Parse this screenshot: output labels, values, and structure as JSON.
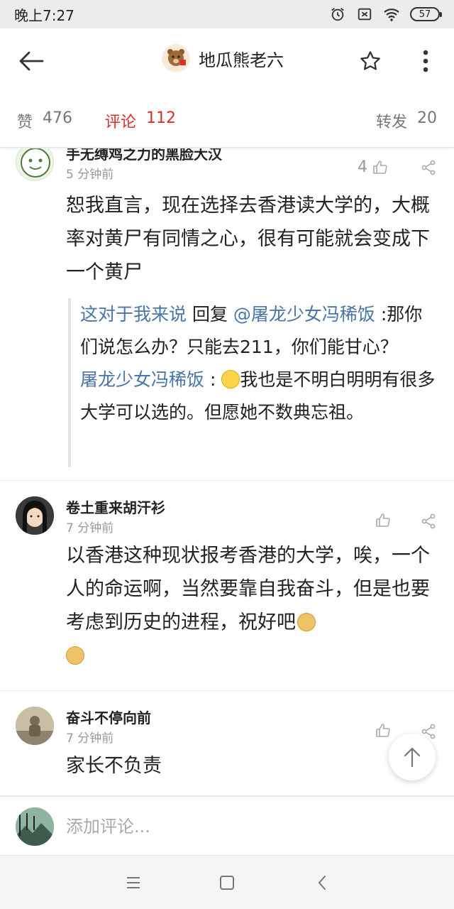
{
  "status_bar": {
    "time": "晚上7:27",
    "battery": "57"
  },
  "header": {
    "title": "地瓜熊老六"
  },
  "tabs": [
    {
      "label": "赞",
      "count": "476"
    },
    {
      "label": "评论",
      "count": "112"
    },
    {
      "label": "转发",
      "count": "20"
    }
  ],
  "comments": [
    {
      "name": "手无缚鸡之力的黑脸大汉",
      "time": "5 分钟前",
      "likes": "4",
      "body": "恕我直言，现在选择去香港读大学的，大概率对黄尸有同情之心，很有可能就会变成下一个黄尸",
      "replies": [
        {
          "author": "这对于我来说",
          "reply_word": " 回复 ",
          "target": "@屠龙少女冯稀饭",
          "text": " :那你们说怎么办？只能去211，你们能甘心？"
        },
        {
          "author": "屠龙少女冯稀饭",
          "colon": " : ",
          "text": "我也是不明白明明有很多大学可以选的。但愿她不数典忘祖。"
        }
      ]
    },
    {
      "name": "卷土重来胡汗衫",
      "time": "7 分钟前",
      "likes": "",
      "body": "以香港这种现状报考香港的大学，唉，一个人的命运啊，当然要靠自我奋斗，但是也要考虑到历史的进程，祝好吧"
    },
    {
      "name": "奋斗不停向前",
      "time": "7 分钟前",
      "likes": "",
      "body": "家长不负责"
    }
  ],
  "input": {
    "placeholder": "添加评论..."
  },
  "colors": {
    "accent": "#d9302a",
    "link": "#4a75a8",
    "muted": "#999999"
  },
  "icons": [
    "back-arrow-icon",
    "star-icon",
    "more-vertical-icon",
    "thumbs-up-icon",
    "share-icon",
    "arrow-up-icon",
    "menu-icon",
    "home-square-icon",
    "back-chevron-icon"
  ]
}
